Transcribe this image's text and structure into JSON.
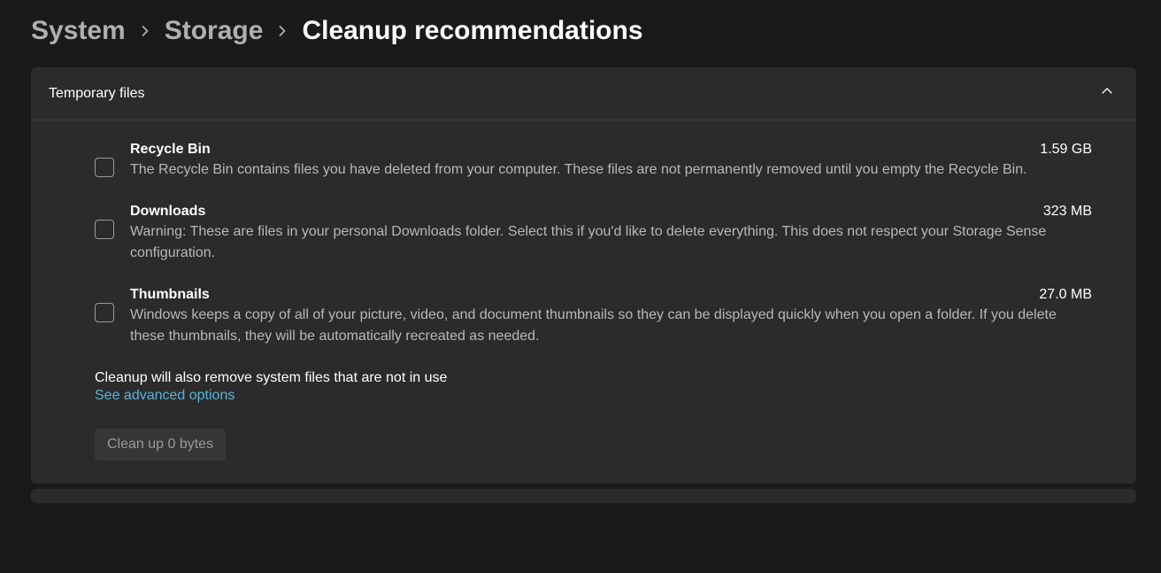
{
  "breadcrumb": {
    "level1": "System",
    "level2": "Storage",
    "current": "Cleanup recommendations"
  },
  "section": {
    "title": "Temporary files",
    "items": [
      {
        "title": "Recycle Bin",
        "size": "1.59 GB",
        "description": "The Recycle Bin contains files you have deleted from your computer. These files are not permanently removed until you empty the Recycle Bin."
      },
      {
        "title": "Downloads",
        "size": "323 MB",
        "description": "Warning: These are files in your personal Downloads folder. Select this if you'd like to delete everything. This does not respect your Storage Sense configuration."
      },
      {
        "title": "Thumbnails",
        "size": "27.0 MB",
        "description": "Windows keeps a copy of all of your picture, video, and document thumbnails so they can be displayed quickly when you open a folder. If you delete these thumbnails, they will be automatically recreated as needed."
      }
    ],
    "footer_text": "Cleanup will also remove system files that are not in use",
    "advanced_link": "See advanced options",
    "cleanup_button": "Clean up 0 bytes"
  }
}
